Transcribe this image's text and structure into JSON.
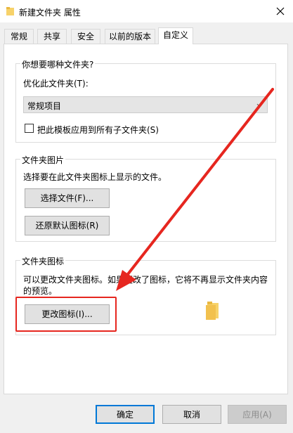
{
  "window": {
    "title": "新建文件夹 属性"
  },
  "tabs": [
    {
      "label": "常规"
    },
    {
      "label": "共享"
    },
    {
      "label": "安全"
    },
    {
      "label": "以前的版本"
    },
    {
      "label": "自定义"
    }
  ],
  "customize": {
    "folder_type": {
      "group_title": "你想要哪种文件夹?",
      "optimize_label": "优化此文件夹(T):",
      "selected": "常规项目",
      "apply_subfolders_label": "把此模板应用到所有子文件夹(S)",
      "apply_subfolders_checked": false
    },
    "folder_picture": {
      "group_title": "文件夹图片",
      "description": "选择要在此文件夹图标上显示的文件。",
      "choose_file_button": "选择文件(F)...",
      "restore_default_button": "还原默认图标(R)"
    },
    "folder_icon": {
      "group_title": "文件夹图标",
      "description_line1": "可以更改文件夹图标。如果更改了图标，它将不再显示文件夹内容",
      "description_line2": "的预览。",
      "change_icon_button": "更改图标(I)..."
    }
  },
  "footer": {
    "ok": "确定",
    "cancel": "取消",
    "apply": "应用(A)"
  },
  "colors": {
    "accent": "#0078d7",
    "annotation": "#e6261f",
    "folder": "#f7d26a"
  },
  "icons": [
    "folder-icon",
    "close-icon",
    "chevron-down-icon",
    "annotation-arrow"
  ]
}
